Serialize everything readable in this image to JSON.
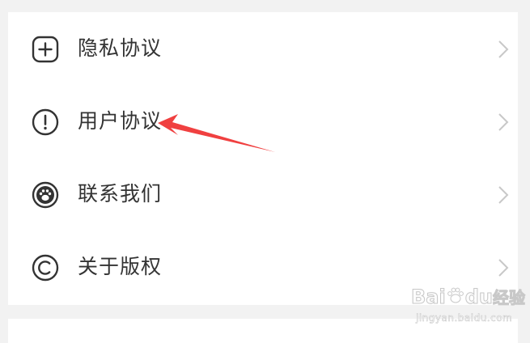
{
  "menu": {
    "items": [
      {
        "label": "隐私协议",
        "icon": "plus-square-icon"
      },
      {
        "label": "用户协议",
        "icon": "exclamation-circle-icon"
      },
      {
        "label": "联系我们",
        "icon": "paw-circle-icon"
      },
      {
        "label": "关于版权",
        "icon": "copyright-icon"
      }
    ]
  },
  "annotation": {
    "arrow_color": "#f04040"
  },
  "watermark": {
    "brand": "Bai",
    "brand_suffix": "du",
    "brand_cn": "经验",
    "url": "jingyan.baidu.com"
  },
  "colors": {
    "background": "#f2f2f2",
    "card": "#ffffff",
    "text": "#333333",
    "icon": "#333333",
    "chevron": "#c8c8c8"
  }
}
